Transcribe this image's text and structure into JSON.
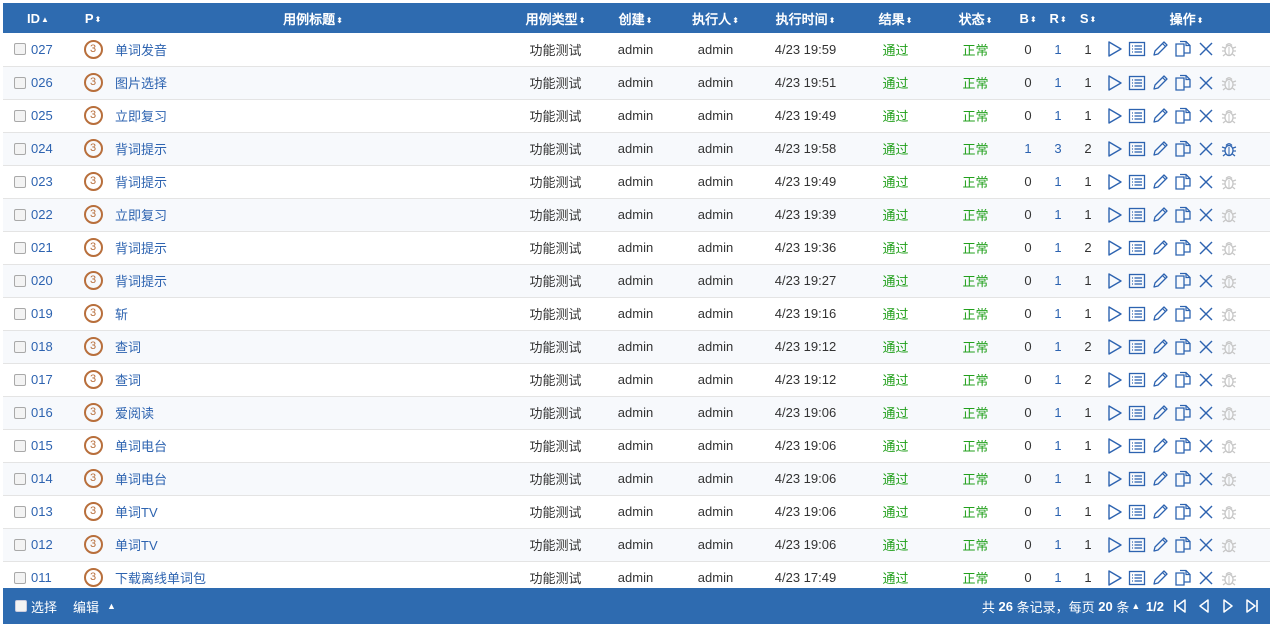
{
  "colors": {
    "header_bg": "#2e6bb0",
    "link": "#2d63b0",
    "priority": "#b86f3c",
    "pass": "#22a01c"
  },
  "columns": {
    "id": "ID",
    "priority": "P",
    "title": "用例标题",
    "type": "用例类型",
    "creator": "创建",
    "executor": "执行人",
    "exec_time": "执行时间",
    "result": "结果",
    "status": "状态",
    "b": "B",
    "r": "R",
    "s": "S",
    "actions": "操作"
  },
  "sort_icons": {
    "id": "▲",
    "other": "⬍"
  },
  "row_actions": [
    "run-icon",
    "list-icon",
    "edit-icon",
    "copy-icon",
    "delete-icon",
    "bug-icon"
  ],
  "rows": [
    {
      "id": "027",
      "p": "3",
      "title": "单词发音",
      "type": "功能测试",
      "creator": "admin",
      "executor": "admin",
      "time": "4/23 19:59",
      "result": "通过",
      "status": "正常",
      "b": "0",
      "r": "1",
      "s": "1",
      "bug_active": false
    },
    {
      "id": "026",
      "p": "3",
      "title": "图片选择",
      "type": "功能测试",
      "creator": "admin",
      "executor": "admin",
      "time": "4/23 19:51",
      "result": "通过",
      "status": "正常",
      "b": "0",
      "r": "1",
      "s": "1",
      "bug_active": false
    },
    {
      "id": "025",
      "p": "3",
      "title": "立即复习",
      "type": "功能测试",
      "creator": "admin",
      "executor": "admin",
      "time": "4/23 19:49",
      "result": "通过",
      "status": "正常",
      "b": "0",
      "r": "1",
      "s": "1",
      "bug_active": false
    },
    {
      "id": "024",
      "p": "3",
      "title": "背词提示",
      "type": "功能测试",
      "creator": "admin",
      "executor": "admin",
      "time": "4/23 19:58",
      "result": "通过",
      "status": "正常",
      "b": "1",
      "r": "3",
      "s": "2",
      "bug_active": true
    },
    {
      "id": "023",
      "p": "3",
      "title": "背词提示",
      "type": "功能测试",
      "creator": "admin",
      "executor": "admin",
      "time": "4/23 19:49",
      "result": "通过",
      "status": "正常",
      "b": "0",
      "r": "1",
      "s": "1",
      "bug_active": false
    },
    {
      "id": "022",
      "p": "3",
      "title": "立即复习",
      "type": "功能测试",
      "creator": "admin",
      "executor": "admin",
      "time": "4/23 19:39",
      "result": "通过",
      "status": "正常",
      "b": "0",
      "r": "1",
      "s": "1",
      "bug_active": false
    },
    {
      "id": "021",
      "p": "3",
      "title": "背词提示",
      "type": "功能测试",
      "creator": "admin",
      "executor": "admin",
      "time": "4/23 19:36",
      "result": "通过",
      "status": "正常",
      "b": "0",
      "r": "1",
      "s": "2",
      "bug_active": false
    },
    {
      "id": "020",
      "p": "3",
      "title": "背词提示",
      "type": "功能测试",
      "creator": "admin",
      "executor": "admin",
      "time": "4/23 19:27",
      "result": "通过",
      "status": "正常",
      "b": "0",
      "r": "1",
      "s": "1",
      "bug_active": false
    },
    {
      "id": "019",
      "p": "3",
      "title": "斩",
      "type": "功能测试",
      "creator": "admin",
      "executor": "admin",
      "time": "4/23 19:16",
      "result": "通过",
      "status": "正常",
      "b": "0",
      "r": "1",
      "s": "1",
      "bug_active": false
    },
    {
      "id": "018",
      "p": "3",
      "title": "查词",
      "type": "功能测试",
      "creator": "admin",
      "executor": "admin",
      "time": "4/23 19:12",
      "result": "通过",
      "status": "正常",
      "b": "0",
      "r": "1",
      "s": "2",
      "bug_active": false
    },
    {
      "id": "017",
      "p": "3",
      "title": "查词",
      "type": "功能测试",
      "creator": "admin",
      "executor": "admin",
      "time": "4/23 19:12",
      "result": "通过",
      "status": "正常",
      "b": "0",
      "r": "1",
      "s": "2",
      "bug_active": false
    },
    {
      "id": "016",
      "p": "3",
      "title": "爱阅读",
      "type": "功能测试",
      "creator": "admin",
      "executor": "admin",
      "time": "4/23 19:06",
      "result": "通过",
      "status": "正常",
      "b": "0",
      "r": "1",
      "s": "1",
      "bug_active": false
    },
    {
      "id": "015",
      "p": "3",
      "title": "单词电台",
      "type": "功能测试",
      "creator": "admin",
      "executor": "admin",
      "time": "4/23 19:06",
      "result": "通过",
      "status": "正常",
      "b": "0",
      "r": "1",
      "s": "1",
      "bug_active": false
    },
    {
      "id": "014",
      "p": "3",
      "title": "单词电台",
      "type": "功能测试",
      "creator": "admin",
      "executor": "admin",
      "time": "4/23 19:06",
      "result": "通过",
      "status": "正常",
      "b": "0",
      "r": "1",
      "s": "1",
      "bug_active": false
    },
    {
      "id": "013",
      "p": "3",
      "title": "单词TV",
      "type": "功能测试",
      "creator": "admin",
      "executor": "admin",
      "time": "4/23 19:06",
      "result": "通过",
      "status": "正常",
      "b": "0",
      "r": "1",
      "s": "1",
      "bug_active": false
    },
    {
      "id": "012",
      "p": "3",
      "title": "单词TV",
      "type": "功能测试",
      "creator": "admin",
      "executor": "admin",
      "time": "4/23 19:06",
      "result": "通过",
      "status": "正常",
      "b": "0",
      "r": "1",
      "s": "1",
      "bug_active": false
    },
    {
      "id": "011",
      "p": "3",
      "title": "下载离线单词包",
      "type": "功能测试",
      "creator": "admin",
      "executor": "admin",
      "time": "4/23 17:49",
      "result": "通过",
      "status": "正常",
      "b": "0",
      "r": "1",
      "s": "1",
      "bug_active": false
    }
  ],
  "footer": {
    "select_label": "选择",
    "edit_label": "编辑",
    "caret": "▲",
    "summary_prefix": "共",
    "total": "26",
    "summary_mid": "条记录，每页",
    "per_page": "20",
    "summary_suffix": "条",
    "page": "1/2",
    "pager_icons": [
      "first-page-icon",
      "prev-page-icon",
      "next-page-icon",
      "last-page-icon"
    ]
  }
}
